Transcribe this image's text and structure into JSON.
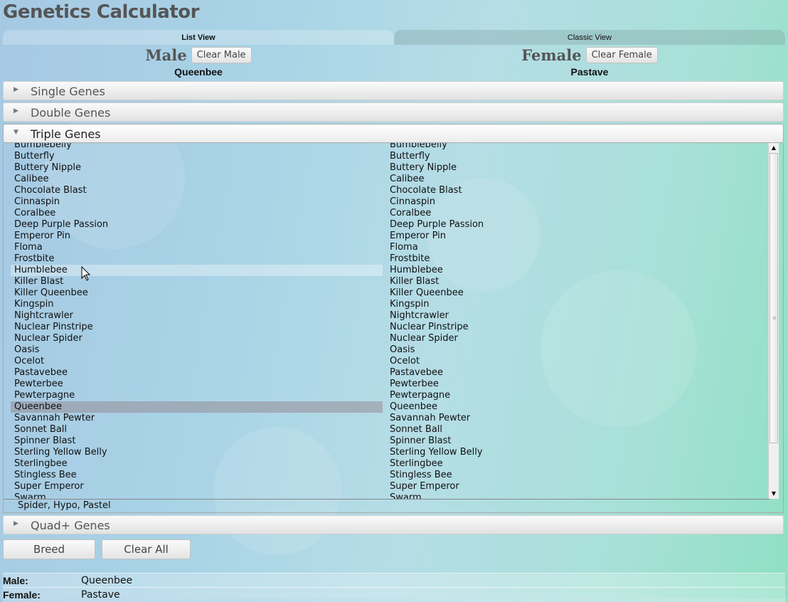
{
  "app": {
    "title": "Genetics Calculator"
  },
  "tabs": {
    "list_view": "List View",
    "classic_view": "Classic View"
  },
  "male": {
    "label": "Male",
    "clear_label": "Clear Male",
    "selected": "Queenbee"
  },
  "female": {
    "label": "Female",
    "clear_label": "Clear Female",
    "selected": "Pastave"
  },
  "sections": {
    "single": "Single Genes",
    "double": "Double Genes",
    "triple": "Triple Genes",
    "quad": "Quad+ Genes"
  },
  "triple_genes_list": [
    "Bumblebelly",
    "Butterfly",
    "Buttery Nipple",
    "Calibee",
    "Chocolate Blast",
    "Cinnaspin",
    "Coralbee",
    "Deep Purple Passion",
    "Emperor Pin",
    "Floma",
    "Frostbite",
    "Humblebee",
    "Killer Blast",
    "Killer Queenbee",
    "Kingspin",
    "Nightcrawler",
    "Nuclear Pinstripe",
    "Nuclear Spider",
    "Oasis",
    "Ocelot",
    "Pastavebee",
    "Pewterbee",
    "Pewterpagne",
    "Queenbee",
    "Savannah Pewter",
    "Sonnet Ball",
    "Spinner Blast",
    "Sterling Yellow Belly",
    "Sterlingbee",
    "Stingless Bee",
    "Super Emperor",
    "Swarm"
  ],
  "list_state": {
    "hovered": "Humblebee",
    "male_selected": "Queenbee"
  },
  "genes_footer": "Spider, Hypo, Pastel",
  "actions": {
    "breed_label": "Breed",
    "clear_all_label": "Clear All"
  },
  "summary": [
    {
      "key": "Male:",
      "value": "Queenbee"
    },
    {
      "key": "Female:",
      "value": "Pastave"
    }
  ]
}
